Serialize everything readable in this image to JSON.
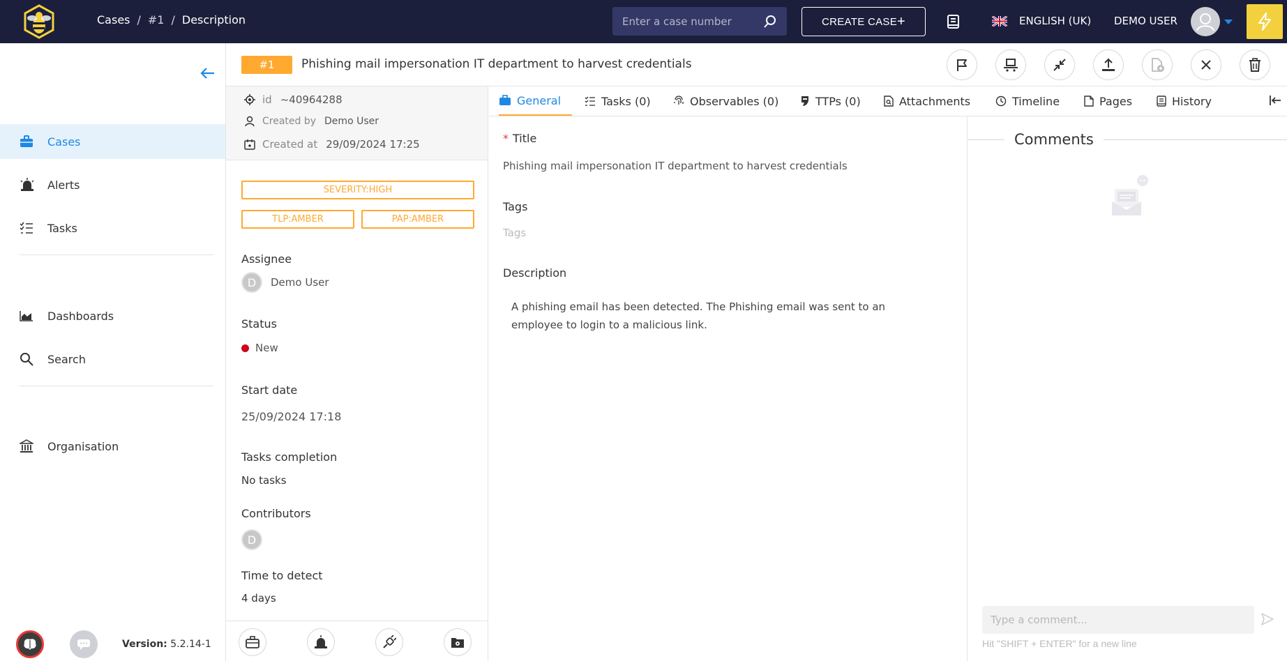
{
  "breadcrumb": [
    "Cases",
    "#1",
    "Description"
  ],
  "search": {
    "placeholder": "Enter a case number"
  },
  "header": {
    "create_label": "CREATE CASE",
    "language": "ENGLISH (UK)",
    "user": "DEMO USER"
  },
  "sidebar": {
    "items": [
      {
        "label": "Cases",
        "icon": "briefcase-icon"
      },
      {
        "label": "Alerts",
        "icon": "siren-icon"
      },
      {
        "label": "Tasks",
        "icon": "tasks-icon"
      },
      {
        "label": "Dashboards",
        "icon": "chart-icon"
      },
      {
        "label": "Search",
        "icon": "search-icon"
      },
      {
        "label": "Organisation",
        "icon": "bank-icon"
      }
    ],
    "version_label": "Version:",
    "version": "5.2.14-1"
  },
  "case": {
    "number": "#1",
    "title": "Phishing mail impersonation IT department to harvest credentials",
    "id_label": "id",
    "id": "~40964288",
    "created_by_label": "Created by",
    "created_by": "Demo User",
    "created_at_label": "Created at",
    "created_at": "29/09/2024 17:25",
    "severity": "SEVERITY:HIGH",
    "tlp": "TLP:AMBER",
    "pap": "PAP:AMBER",
    "assignee_label": "Assignee",
    "assignee_initial": "D",
    "assignee": "Demo User",
    "status_label": "Status",
    "status": "New",
    "start_date_label": "Start date",
    "start_date": "25/09/2024 17:18",
    "tasks_completion_label": "Tasks completion",
    "tasks_completion": "No tasks",
    "contributors_label": "Contributors",
    "contributor_initial": "D",
    "time_to_detect_label": "Time to detect",
    "time_to_detect": "4 days"
  },
  "tabs": [
    {
      "label": "General"
    },
    {
      "label": "Tasks (0)"
    },
    {
      "label": "Observables (0)"
    },
    {
      "label": "TTPs (0)"
    },
    {
      "label": "Attachments"
    },
    {
      "label": "Timeline"
    },
    {
      "label": "Pages"
    },
    {
      "label": "History"
    }
  ],
  "general": {
    "required_mark": "*",
    "title_label": "Title",
    "title": "Phishing mail impersonation IT department to harvest credentials",
    "tags_label": "Tags",
    "tags_placeholder": "Tags",
    "description_label": "Description",
    "description": "A phishing email has been detected. The Phishing email was sent to an employee to login to a malicious link."
  },
  "comments": {
    "title": "Comments",
    "placeholder": "Type a comment...",
    "hint": "Hit \"SHIFT + ENTER\" for a new line"
  },
  "colors": {
    "topbar": "#1b1f3b",
    "accent": "#1e88e5",
    "case_badge": "#ffa930",
    "status_new": "#d0021b",
    "bolt": "#f3d03e"
  }
}
